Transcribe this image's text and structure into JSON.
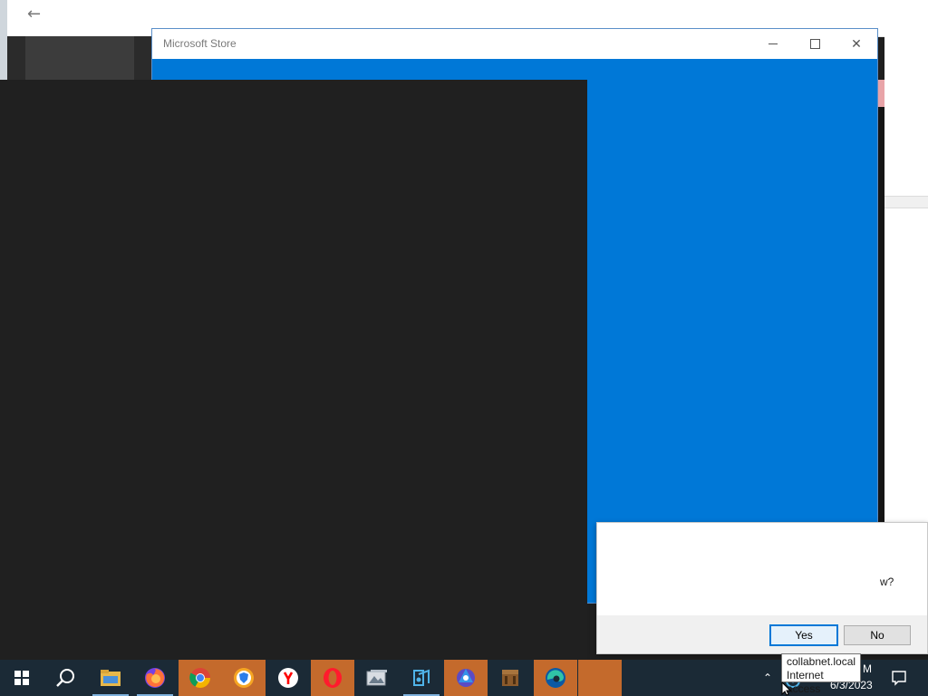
{
  "background_app": {
    "back_icon": "arrow-left-icon"
  },
  "store_window": {
    "title": "Microsoft Store",
    "accent_color": "#0078d7",
    "controls": [
      "minimize-icon",
      "maximize-icon",
      "close-icon"
    ]
  },
  "dialog": {
    "question_fragment": "w?",
    "yes_label": "Yes",
    "no_label": "No"
  },
  "tooltip": {
    "line1": "collabnet.local",
    "line2": "Internet access"
  },
  "taskbar": {
    "apps": [
      {
        "name": "file-explorer",
        "icon": "folder-icon",
        "active": false,
        "running": true
      },
      {
        "name": "firefox",
        "icon": "firefox-icon",
        "active": false,
        "running": true
      },
      {
        "name": "chrome",
        "icon": "chrome-icon",
        "active": true,
        "running": false
      },
      {
        "name": "browser-shield",
        "icon": "shield-browser-icon",
        "active": true,
        "running": false
      },
      {
        "name": "yandex",
        "icon": "yandex-icon",
        "active": false,
        "running": false
      },
      {
        "name": "opera",
        "icon": "opera-icon",
        "active": true,
        "running": false
      },
      {
        "name": "image-viewer",
        "icon": "image-icon",
        "active": false,
        "running": false
      },
      {
        "name": "dev-tool",
        "icon": "dev-icon",
        "active": false,
        "running": true
      },
      {
        "name": "media-app",
        "icon": "media-icon",
        "active": true,
        "running": false
      },
      {
        "name": "crafting-app",
        "icon": "crafting-table-icon",
        "active": false,
        "running": false
      },
      {
        "name": "edge",
        "icon": "edge-icon",
        "active": true,
        "running": false
      },
      {
        "name": "store-placeholder",
        "icon": "",
        "active": true,
        "running": false
      }
    ],
    "clock_time_fragment": "M",
    "clock_date": "6/3/2023",
    "taskbar_color": "#1b2a36",
    "active_color": "#c46a2c"
  }
}
